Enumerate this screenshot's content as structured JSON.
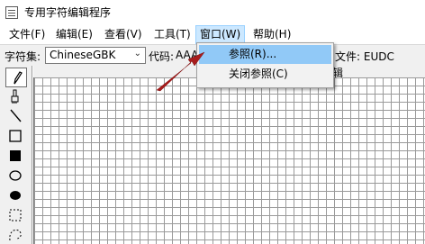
{
  "window": {
    "title": "专用字符编辑程序"
  },
  "menubar": {
    "items": [
      {
        "label": "文件(F)"
      },
      {
        "label": "编辑(E)"
      },
      {
        "label": "查看(V)"
      },
      {
        "label": "工具(T)"
      },
      {
        "label": "窗口(W)",
        "active": true
      },
      {
        "label": "帮助(H)"
      }
    ]
  },
  "toolbar": {
    "charset_label": "字符集:",
    "charset_value": "ChineseGBK",
    "code_label": "代码:",
    "code_value": "AAA",
    "file_label": "文件: EUDC"
  },
  "dropdown": {
    "items": [
      {
        "label": "参照(R)...",
        "highlighted": true
      },
      {
        "label": "关闭参照(C)"
      }
    ]
  },
  "editor": {
    "caption": "辑"
  },
  "palette": {
    "tools": [
      {
        "icon": "pencil-icon",
        "selected": true
      },
      {
        "icon": "brush-icon"
      },
      {
        "icon": "line-icon"
      },
      {
        "icon": "hollow-rectangle-icon"
      },
      {
        "icon": "filled-rectangle-icon"
      },
      {
        "icon": "hollow-ellipse-icon"
      },
      {
        "icon": "filled-ellipse-icon"
      },
      {
        "icon": "rectangular-select-icon"
      },
      {
        "icon": "freeform-select-icon"
      }
    ]
  },
  "colors": {
    "menu_active_bg": "#cce8ff",
    "dropdown_highlight": "#91c9f7",
    "annotation_arrow": "#a81c1c",
    "grid_line": "#9a9a9a"
  }
}
